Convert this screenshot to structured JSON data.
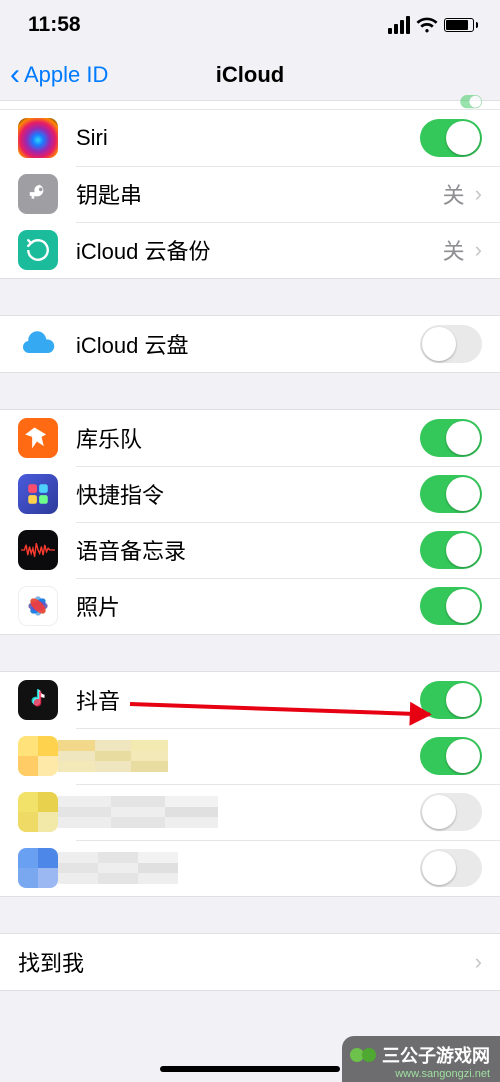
{
  "status": {
    "time": "11:58"
  },
  "nav": {
    "back_label": "Apple ID",
    "title": "iCloud"
  },
  "section1": {
    "siri": {
      "label": "Siri",
      "on": true
    },
    "keychain": {
      "label": "钥匙串",
      "value": "关"
    },
    "backup": {
      "label": "iCloud 云备份",
      "value": "关"
    }
  },
  "section2": {
    "drive": {
      "label": "iCloud 云盘",
      "on": false
    }
  },
  "section3": {
    "garageband": {
      "label": "库乐队",
      "on": true
    },
    "shortcuts": {
      "label": "快捷指令",
      "on": true
    },
    "voicememos": {
      "label": "语音备忘录",
      "on": true
    },
    "photos": {
      "label": "照片",
      "on": true
    }
  },
  "section4": {
    "douyin": {
      "label": "抖音",
      "on": true
    },
    "hidden1": {
      "on": true
    },
    "hidden2": {
      "on": false
    },
    "hidden3": {
      "on": false
    }
  },
  "section5": {
    "findme": {
      "label": "找到我"
    }
  },
  "watermark": {
    "brand": "三公子游戏网",
    "url": "www.sangongzi.net"
  }
}
